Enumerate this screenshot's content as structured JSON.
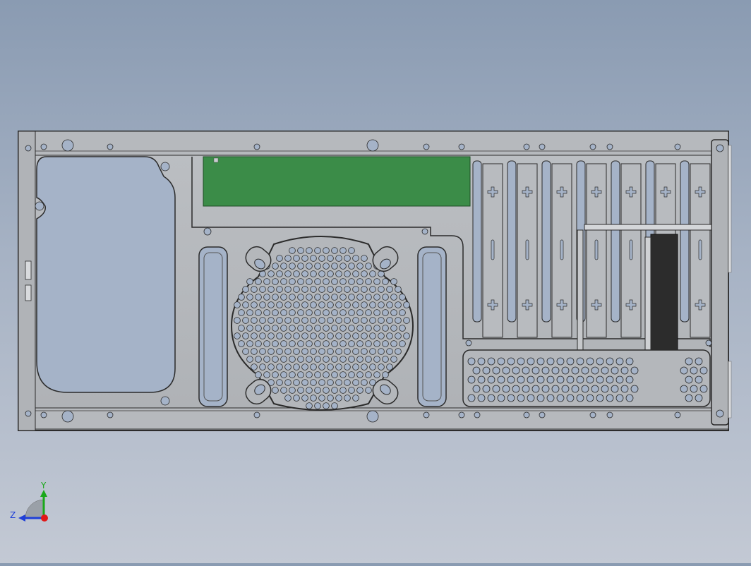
{
  "viewport": {
    "background_top": "#8a9bb2",
    "background_bottom": "#c3c9d4"
  },
  "model": {
    "sheet_color": "#b4b7bb",
    "edge_color": "#2b2b2b",
    "hole_color": "#a5b3c8",
    "pcb_color": "#3b8c48",
    "fan_color": "#2c2c2c"
  },
  "triad": {
    "y_label": "Y",
    "z_label": "Z",
    "y_color": "#1aa81a",
    "z_color": "#1f3fd8",
    "x_color": "#e01818"
  }
}
